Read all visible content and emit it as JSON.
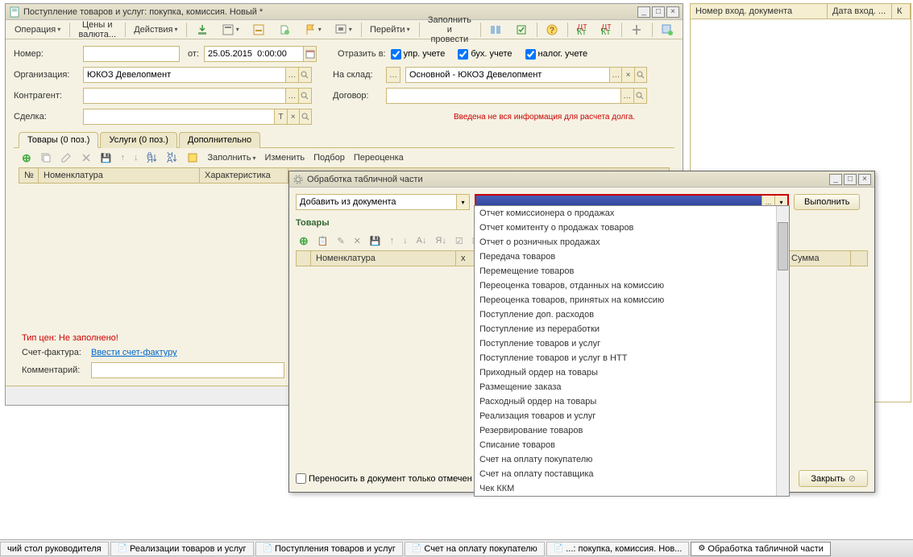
{
  "mainWindow": {
    "title": "Поступление товаров и услуг: покупка, комиссия. Новый *",
    "toolbar": {
      "operation": "Операция",
      "pricesCurrency": "Цены и валюта...",
      "actions": "Действия",
      "goto": "Перейти",
      "fillProcess": "Заполнить и провести"
    },
    "fields": {
      "numberLabel": "Номер:",
      "fromLabel": "от:",
      "dateValue": "25.05.2015  0:00:00",
      "orgLabel": "Организация:",
      "orgValue": "ЮКОЗ Девелопмент",
      "counterpartyLabel": "Контрагент:",
      "dealLabel": "Сделка:",
      "reflectLabel": "Отразить в:",
      "chkMgmt": "упр. учете",
      "chkAcc": "бух. учете",
      "chkTax": "налог. учете",
      "warehouseLabel": "На склад:",
      "warehouseValue": "Основной - ЮКОЗ Девелопмент",
      "contractLabel": "Договор:",
      "warningText": "Введена не вся информация для расчета долга."
    },
    "tabs": {
      "goods": "Товары (0 поз.)",
      "services": "Услуги (0 поз.)",
      "additional": "Дополнительно"
    },
    "subToolbar": {
      "fill": "Заполнить",
      "change": "Изменить",
      "select": "Подбор",
      "revalue": "Переоценка"
    },
    "gridColumns": {
      "num": "№",
      "nomenclature": "Номенклатура",
      "characteristic": "Характеристика"
    },
    "bottom": {
      "priceTypeLabel": "Тип цен: Не заполнено!",
      "invoiceLabel": "Счет-фактура:",
      "invoiceLink": "Ввести счет-фактуру",
      "commentLabel": "Комментарий:"
    }
  },
  "rightGrid": {
    "col1": "Номер вход. документа",
    "col2": "Дата вход. ...",
    "col3": "К"
  },
  "popup": {
    "title": "Обработка табличной части",
    "addFromDoc": "Добавить из документа",
    "execute": "Выполнить",
    "goodsTitle": "Товары",
    "gridCol1": "Номенклатура",
    "gridCol2": "Сумма",
    "transferOnly": "Переносить в документ только отмечен",
    "close": "Закрыть"
  },
  "dropdownItems": [
    "Отчет комиссионера о продажах",
    "Отчет комитенту о продажах товаров",
    "Отчет о розничных продажах",
    "Передача товаров",
    "Перемещение товаров",
    "Переоценка товаров, отданных на комиссию",
    "Переоценка товаров, принятых на комиссию",
    "Поступление доп. расходов",
    "Поступление из переработки",
    "Поступление товаров и услуг",
    "Поступление товаров и услуг в НТТ",
    "Приходный ордер на товары",
    "Размещение заказа",
    "Расходный ордер на товары",
    "Реализация товаров и услуг",
    "Резервирование товаров",
    "Списание товаров",
    "Счет на оплату покупателю",
    "Счет на оплату поставщика",
    "Чек ККМ"
  ],
  "taskbar": {
    "item1": "чий стол руководителя",
    "item2": "Реализации товаров и услуг",
    "item3": "Поступления товаров и услуг",
    "item4": "Счет на оплату покупателю",
    "item5": "...: покупка, комиссия. Нов...",
    "item6": "Обработка табличной части"
  }
}
